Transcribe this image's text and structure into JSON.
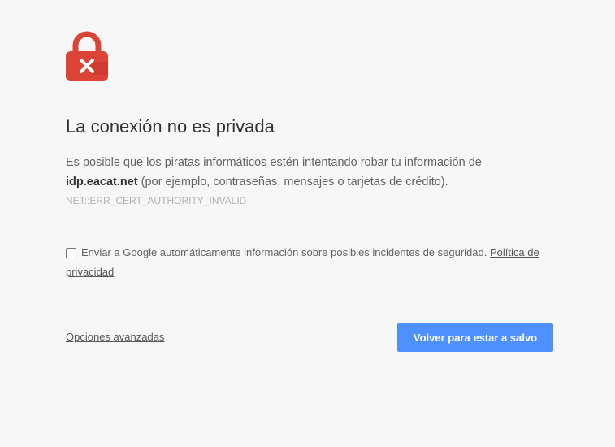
{
  "icon": {
    "name": "lock-error-icon",
    "color": "#db4437"
  },
  "heading": "La conexión no es privada",
  "message": {
    "text_1": "Es posible que los piratas informáticos estén intentando robar tu información de",
    "domain": "idp.eacat.net",
    "text_2": " (por ejemplo, contraseñas, mensajes o tarjetas de crédito)."
  },
  "error_code": "NET::ERR_CERT_AUTHORITY_INVALID",
  "optin": {
    "checked": false,
    "text": "Enviar a Google automáticamente información sobre posibles incidentes de seguridad.",
    "link": "Política de privacidad"
  },
  "advanced_link": "Opciones avanzadas",
  "primary_button": "Volver para estar a salvo",
  "colors": {
    "accent": "#4d90fe",
    "danger": "#db4437",
    "background": "#f7f7f7"
  }
}
